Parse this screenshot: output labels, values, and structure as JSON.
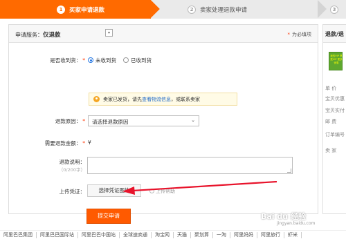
{
  "steps": [
    {
      "num": "1",
      "label": "买家申请退款"
    },
    {
      "num": "2",
      "label": "卖家处理退款申请"
    },
    {
      "num": "3",
      "label": ""
    }
  ],
  "header": {
    "service_label": "申请服务：",
    "service_value": "仅退款",
    "required_note": "为必填项"
  },
  "form": {
    "received_label": "是否收到货：",
    "received_options": [
      "未收到货",
      "已收到货"
    ],
    "tip_prefix": "卖家已发货，请先",
    "tip_link": "查看物流信息",
    "tip_suffix": "，或联系卖家",
    "reason_label": "退款原因：",
    "reason_placeholder": "请选择退款原因",
    "amount_label": "需要退款金额：",
    "amount_value": "¥",
    "desc_label": "退款说明：",
    "desc_counter": "（0/200字）",
    "upload_label": "上传凭证：",
    "upload_button": "选择凭证图片",
    "upload_help": "上传帮助",
    "submit_button": "提交申请"
  },
  "right_panel": {
    "title": "退款/退",
    "thumb_text": "我的VIP 享受VIP 更多优惠",
    "items": [
      "单 价",
      "宝贝优惠",
      "宝贝实付",
      "邮 费",
      "订单编号",
      "卖 家"
    ]
  },
  "footer": {
    "links": [
      "阿里巴巴集团",
      "阿里巴巴国际站",
      "阿里巴巴中国站",
      "全球速卖通",
      "淘宝网",
      "天猫",
      "聚划算",
      "一淘",
      "阿里妈妈",
      "阿里旅行",
      "虾米"
    ]
  },
  "watermark": {
    "text": "Bai du 经验",
    "sub": "jingyan.baidu.com"
  },
  "colors": {
    "accent": "#ff6a00",
    "submit": "#ff5a00",
    "link": "#1a66c7",
    "arrow": "#e8132b"
  }
}
